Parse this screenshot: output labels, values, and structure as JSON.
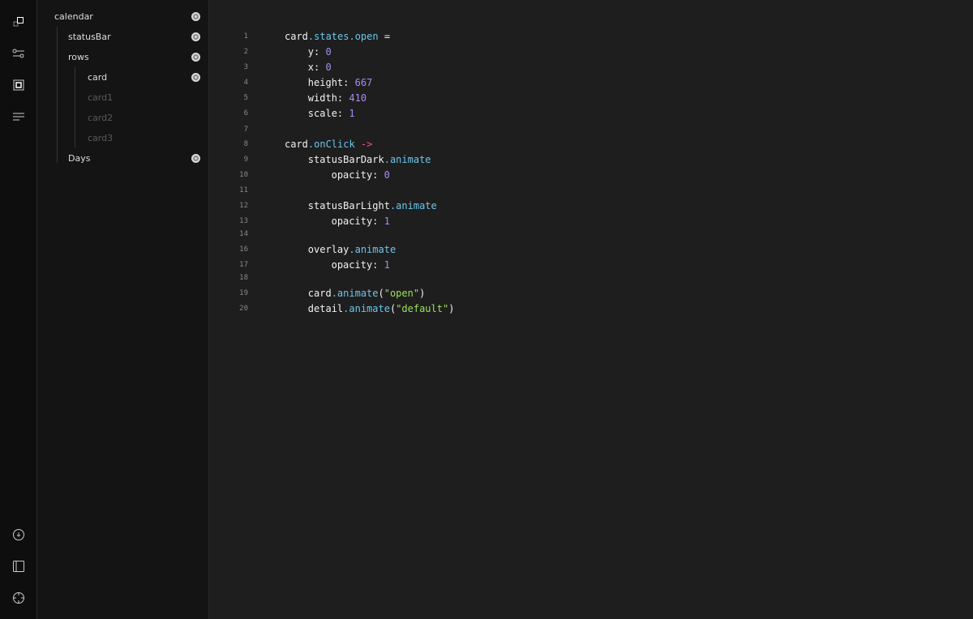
{
  "rail": {
    "top_icons": [
      "layers-icon",
      "sliders-icon",
      "frame-icon",
      "menu-lines-icon"
    ],
    "bottom_icons": [
      "download-icon",
      "panel-icon",
      "crosshair-icon"
    ]
  },
  "tree": [
    {
      "label": "calendar",
      "visible": true,
      "dim": false
    },
    {
      "label": "statusBar",
      "visible": true,
      "dim": false
    },
    {
      "label": "rows",
      "visible": true,
      "dim": false
    },
    {
      "label": "card",
      "visible": true,
      "dim": false
    },
    {
      "label": "card1",
      "visible": false,
      "dim": true
    },
    {
      "label": "card2",
      "visible": false,
      "dim": true
    },
    {
      "label": "card3",
      "visible": false,
      "dim": true
    },
    {
      "label": "Days",
      "visible": true,
      "dim": false
    }
  ],
  "colors": {
    "property": "#6cc6ea",
    "number": "#a88cf2",
    "operator": "#e8559c",
    "string": "#9ee25c"
  },
  "code": [
    {
      "n": "1",
      "indent": 0,
      "tokens": [
        {
          "t": "card",
          "c": "plain"
        },
        {
          "t": ".states.open",
          "c": "prop"
        },
        {
          "t": " =",
          "c": "plain"
        }
      ]
    },
    {
      "n": "2",
      "indent": 1,
      "tokens": [
        {
          "t": "y: ",
          "c": "plain"
        },
        {
          "t": "0",
          "c": "num"
        }
      ]
    },
    {
      "n": "3",
      "indent": 1,
      "tokens": [
        {
          "t": "x: ",
          "c": "plain"
        },
        {
          "t": "0",
          "c": "num"
        }
      ]
    },
    {
      "n": "4",
      "indent": 1,
      "tokens": [
        {
          "t": "height: ",
          "c": "plain"
        },
        {
          "t": "667",
          "c": "num"
        }
      ]
    },
    {
      "n": "5",
      "indent": 1,
      "tokens": [
        {
          "t": "width: ",
          "c": "plain"
        },
        {
          "t": "410",
          "c": "num"
        }
      ]
    },
    {
      "n": "6",
      "indent": 1,
      "tokens": [
        {
          "t": "scale: ",
          "c": "plain"
        },
        {
          "t": "1",
          "c": "num"
        }
      ]
    },
    {
      "n": "7",
      "indent": 0,
      "tokens": []
    },
    {
      "n": "8",
      "indent": 0,
      "tokens": [
        {
          "t": "card",
          "c": "plain"
        },
        {
          "t": ".onClick",
          "c": "prop"
        },
        {
          "t": " ->",
          "c": "op"
        }
      ]
    },
    {
      "n": "9",
      "indent": 1,
      "tokens": [
        {
          "t": "statusBarDark",
          "c": "plain"
        },
        {
          "t": ".animate",
          "c": "prop"
        }
      ]
    },
    {
      "n": "10",
      "indent": 2,
      "tokens": [
        {
          "t": "opacity: ",
          "c": "plain"
        },
        {
          "t": "0",
          "c": "num"
        }
      ]
    },
    {
      "n": "11",
      "indent": 0,
      "tokens": []
    },
    {
      "n": "12",
      "indent": 1,
      "tokens": [
        {
          "t": "statusBarLight",
          "c": "plain"
        },
        {
          "t": ".animate",
          "c": "prop"
        }
      ]
    },
    {
      "n": "13",
      "indent": 2,
      "tokens": [
        {
          "t": "opacity: ",
          "c": "plain"
        },
        {
          "t": "1",
          "c": "num"
        }
      ]
    },
    {
      "n": "14",
      "indent": 0,
      "tokens": []
    },
    {
      "n": "16",
      "indent": 1,
      "tokens": [
        {
          "t": "overlay",
          "c": "plain"
        },
        {
          "t": ".animate",
          "c": "prop"
        }
      ]
    },
    {
      "n": "17",
      "indent": 2,
      "tokens": [
        {
          "t": "opacity: ",
          "c": "plain"
        },
        {
          "t": "1",
          "c": "num"
        }
      ]
    },
    {
      "n": "18",
      "indent": 0,
      "tokens": []
    },
    {
      "n": "19",
      "indent": 1,
      "tokens": [
        {
          "t": "card",
          "c": "plain"
        },
        {
          "t": ".animate",
          "c": "prop"
        },
        {
          "t": "(",
          "c": "plain"
        },
        {
          "t": "\"open\"",
          "c": "str"
        },
        {
          "t": ")",
          "c": "plain"
        }
      ]
    },
    {
      "n": "20",
      "indent": 1,
      "tokens": [
        {
          "t": "detail",
          "c": "plain"
        },
        {
          "t": ".animate",
          "c": "prop"
        },
        {
          "t": "(",
          "c": "plain"
        },
        {
          "t": "\"default\"",
          "c": "str"
        },
        {
          "t": ")",
          "c": "plain"
        }
      ]
    }
  ]
}
